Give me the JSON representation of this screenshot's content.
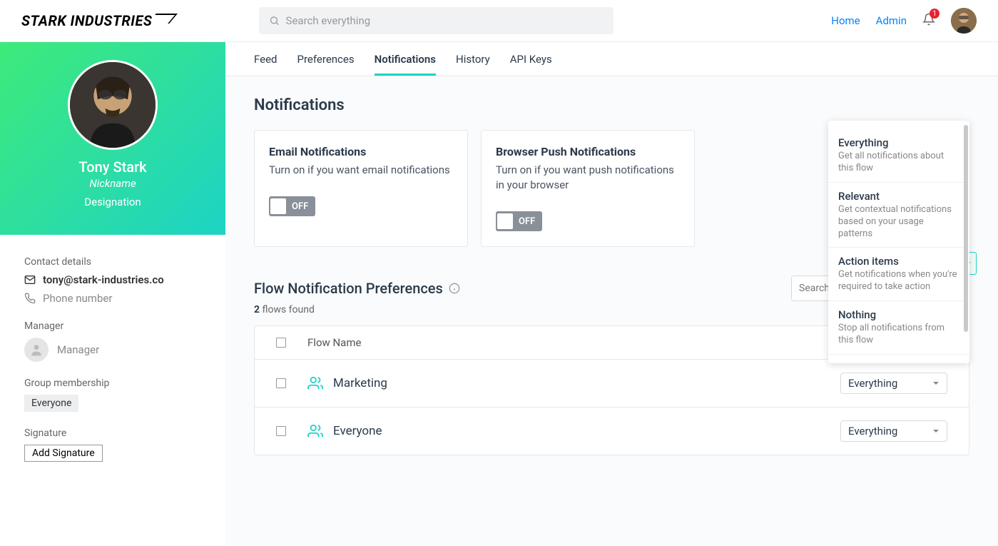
{
  "header": {
    "logo": "STARK INDUSTRIES",
    "search_placeholder": "Search everything",
    "home": "Home",
    "admin": "Admin",
    "notification_count": "1"
  },
  "profile": {
    "name": "Tony Stark",
    "nickname": "Nickname",
    "designation": "Designation"
  },
  "contact": {
    "label": "Contact details",
    "email": "tony@stark-industries.co",
    "phone": "Phone number"
  },
  "manager": {
    "label": "Manager",
    "value": "Manager"
  },
  "group": {
    "label": "Group membership",
    "value": "Everyone"
  },
  "signature": {
    "label": "Signature",
    "button": "Add Signature"
  },
  "tabs": {
    "feed": "Feed",
    "preferences": "Preferences",
    "notifications": "Notifications",
    "history": "History",
    "apikeys": "API Keys"
  },
  "page": {
    "title": "Notifications"
  },
  "cards": {
    "email": {
      "title": "Email Notifications",
      "desc": "Turn on if you want email notifications",
      "state": "OFF"
    },
    "browser": {
      "title": "Browser Push Notifications",
      "desc": "Turn on if you want push notifications in your browser",
      "state": "OFF"
    }
  },
  "flowprefs": {
    "title": "Flow Notification Preferences",
    "search_placeholder": "Search flows",
    "count": "2",
    "count_label": " flows found",
    "col_flowname": "Flow Name",
    "rows": [
      {
        "name": "Marketing",
        "value": "Everything"
      },
      {
        "name": "Everyone",
        "value": "Everything"
      }
    ]
  },
  "dropdown": {
    "items": [
      {
        "title": "Everything",
        "desc": "Get all notifications about this flow"
      },
      {
        "title": "Relevant",
        "desc": "Get contextual notifications based on your usage patterns"
      },
      {
        "title": "Action items",
        "desc": "Get notifications when you're required to take action"
      },
      {
        "title": "Nothing",
        "desc": "Stop all notifications from this flow"
      }
    ]
  }
}
